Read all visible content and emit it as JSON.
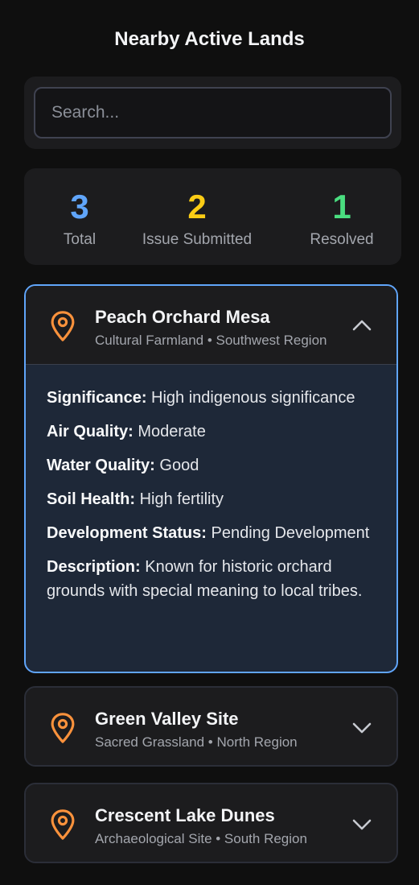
{
  "page": {
    "title": "Nearby Active Lands"
  },
  "search": {
    "placeholder": "Search..."
  },
  "stats": [
    {
      "value": "3",
      "label": "Total",
      "color": "#60a5fa"
    },
    {
      "value": "2",
      "label": "Issue Submitted",
      "color": "#facc15"
    },
    {
      "value": "1",
      "label": "Resolved",
      "color": "#4ade80"
    }
  ],
  "lands": [
    {
      "name": "Peach Orchard Mesa",
      "subtitle": "Cultural Farmland • Southwest Region",
      "expanded": true,
      "icon": "map-pin-icon",
      "chevron": "chevron-up-icon",
      "details": [
        {
          "key": "Significance:",
          "value": "High indigenous significance"
        },
        {
          "key": "Air Quality:",
          "value": "Moderate"
        },
        {
          "key": "Water Quality:",
          "value": "Good"
        },
        {
          "key": "Soil Health:",
          "value": "High fertility"
        },
        {
          "key": "Development Status:",
          "value": "Pending Development"
        },
        {
          "key": "Description:",
          "value": "Known for historic orchard grounds with special meaning to local tribes."
        }
      ]
    },
    {
      "name": "Green Valley Site",
      "subtitle": "Sacred Grassland • North Region",
      "expanded": false,
      "icon": "map-pin-icon",
      "chevron": "chevron-down-icon"
    },
    {
      "name": "Crescent Lake Dunes",
      "subtitle": "Archaeological Site • South Region",
      "expanded": false,
      "icon": "map-pin-icon",
      "chevron": "chevron-down-icon"
    }
  ],
  "colors": {
    "pin": "#fb923c",
    "accent_border": "#60a5fa"
  }
}
